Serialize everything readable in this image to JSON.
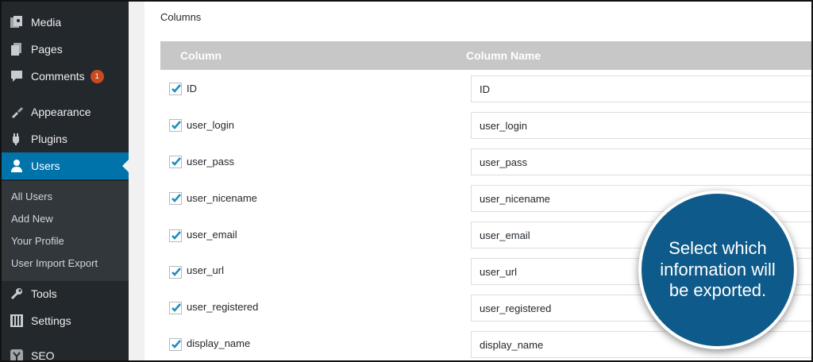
{
  "sidebar": {
    "items": [
      {
        "label": "Media",
        "icon": "media-icon"
      },
      {
        "label": "Pages",
        "icon": "pages-icon"
      },
      {
        "label": "Comments",
        "icon": "comments-icon",
        "badge": "1"
      },
      {
        "label": "Appearance",
        "icon": "appearance-icon"
      },
      {
        "label": "Plugins",
        "icon": "plugins-icon"
      },
      {
        "label": "Users",
        "icon": "users-icon",
        "active": true
      },
      {
        "label": "Tools",
        "icon": "tools-icon"
      },
      {
        "label": "Settings",
        "icon": "settings-icon"
      },
      {
        "label": "SEO",
        "icon": "seo-icon"
      }
    ],
    "submenu": [
      "All Users",
      "Add New",
      "Your Profile",
      "User Import Export"
    ]
  },
  "main": {
    "section_title": "Columns",
    "headers": {
      "column": "Column",
      "column_name": "Column Name"
    },
    "rows": [
      {
        "label": "ID",
        "value": "ID",
        "checked": true
      },
      {
        "label": "user_login",
        "value": "user_login",
        "checked": true
      },
      {
        "label": "user_pass",
        "value": "user_pass",
        "checked": true
      },
      {
        "label": "user_nicename",
        "value": "user_nicename",
        "checked": true
      },
      {
        "label": "user_email",
        "value": "user_email",
        "checked": true
      },
      {
        "label": "user_url",
        "value": "user_url",
        "checked": true
      },
      {
        "label": "user_registered",
        "value": "user_registered",
        "checked": true
      },
      {
        "label": "display_name",
        "value": "display_name",
        "checked": true
      }
    ]
  },
  "callout": {
    "text": "Select which information will be exported."
  },
  "colors": {
    "sidebar_bg": "#23282d",
    "active": "#0073aa",
    "callout": "#0e5a8a",
    "check": "#1e8cbe",
    "badge": "#ca4a1f"
  }
}
